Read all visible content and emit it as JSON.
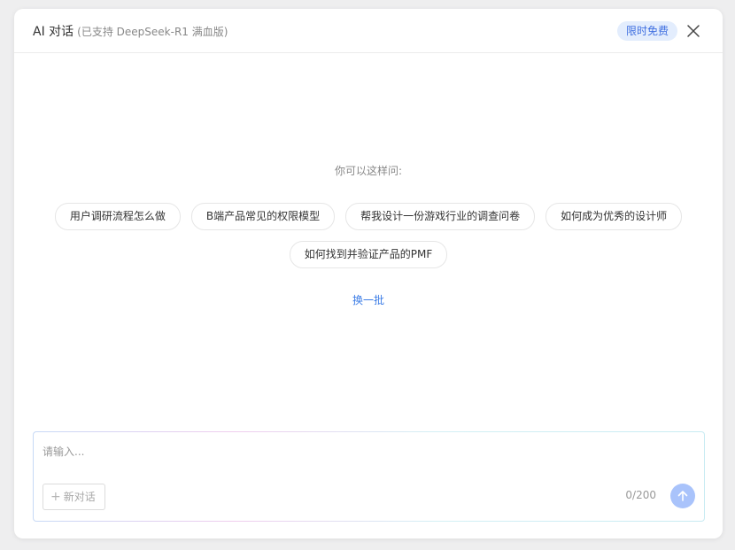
{
  "header": {
    "title": "AI 对话",
    "subtitle": "(已支持 DeepSeek-R1 满血版)",
    "badge": "限时免费"
  },
  "prompts": {
    "hint": "你可以这样问:",
    "items": [
      "用户调研流程怎么做",
      "B端产品常见的权限模型",
      "帮我设计一份游戏行业的调查问卷",
      "如何成为优秀的设计师",
      "如何找到并验证产品的PMF"
    ],
    "refresh_label": "换一批"
  },
  "composer": {
    "placeholder": "请输入...",
    "new_chat_label": "新对话",
    "char_count": "0/200"
  },
  "colors": {
    "accent": "#3d7de6",
    "badge_bg": "#e3edfd",
    "send_button": "#a9c3fb"
  },
  "icons": {
    "close": "close-icon",
    "plus": "plus-icon",
    "send": "arrow-up-icon"
  }
}
